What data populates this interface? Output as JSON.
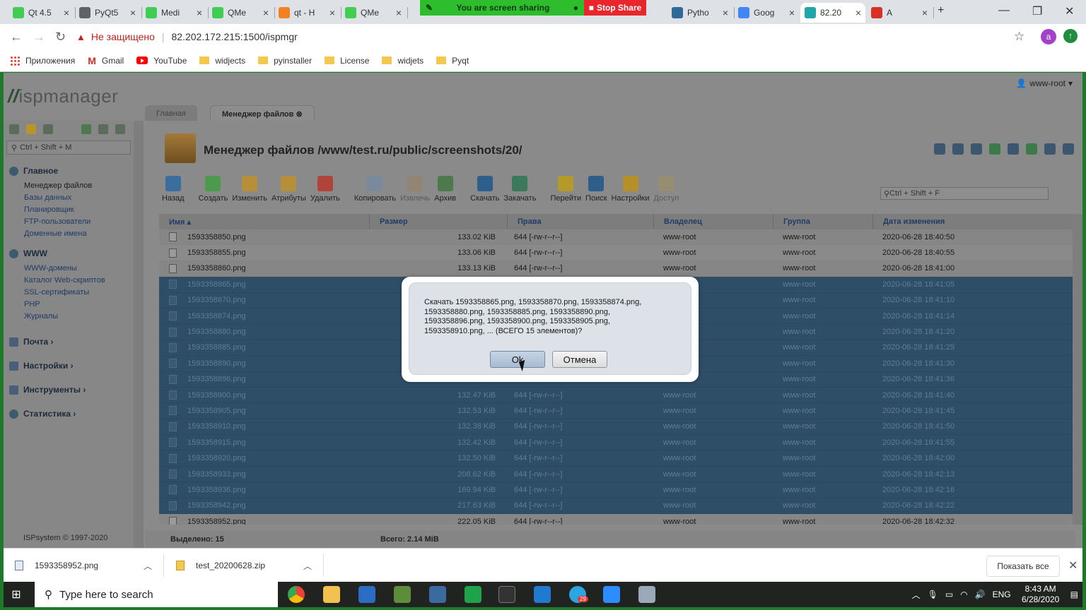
{
  "browser": {
    "tabs": [
      {
        "label": "Qt 4.5",
        "icon": "qt-icon"
      },
      {
        "label": "PyQt5",
        "icon": "globe-icon"
      },
      {
        "label": "Medi",
        "icon": "qt-icon"
      },
      {
        "label": "QMe",
        "icon": "qt-icon"
      },
      {
        "label": "qt - H",
        "icon": "stackoverflow-icon"
      },
      {
        "label": "QMe",
        "icon": "qt-icon"
      },
      {
        "label": "Pytho",
        "icon": "python-icon"
      },
      {
        "label": "Goog",
        "icon": "translate-icon"
      },
      {
        "label": "82.20",
        "icon": "ispmanager-icon"
      },
      {
        "label": "A",
        "icon": "record-icon"
      }
    ],
    "share_text": "You are screen sharing",
    "stop_share_label": "Stop Share",
    "insecure_label": "Не защищено",
    "url": "82.202.172.215:1500/ispmgr",
    "avatar_letter": "a",
    "bookmarks": [
      {
        "label": "Приложения",
        "icon": "apps-icon"
      },
      {
        "label": "Gmail",
        "icon": "gmail-icon"
      },
      {
        "label": "YouTube",
        "icon": "youtube-icon"
      },
      {
        "label": "widjects",
        "icon": "folder-icon"
      },
      {
        "label": "pyinstaller",
        "icon": "folder-icon"
      },
      {
        "label": "License",
        "icon": "folder-icon"
      },
      {
        "label": "widjets",
        "icon": "folder-icon"
      },
      {
        "label": "Pyqt",
        "icon": "folder-icon"
      }
    ]
  },
  "app": {
    "logo_prefix": "//",
    "logo_text": "ispmanager",
    "user": "www-root",
    "tabs": [
      "Главная",
      "Менеджер файлов"
    ],
    "sidebar_search_placeholder": "Ctrl + Shift + M",
    "sections": [
      {
        "title": "Главное",
        "items": [
          "Менеджер файлов",
          "Базы данных",
          "Планировщик",
          "FTP-пользователи",
          "Доменные имена"
        ]
      },
      {
        "title": "WWW",
        "items": [
          "WWW-домены",
          "Каталог Web-скриптов",
          "SSL-сертификаты",
          "PHP",
          "Журналы"
        ]
      },
      {
        "title": "Почта ›",
        "items": []
      },
      {
        "title": "Настройки ›",
        "items": []
      },
      {
        "title": "Инструменты ›",
        "items": []
      },
      {
        "title": "Статистика ›",
        "items": []
      }
    ],
    "copyright": "ISPsystem © 1997-2020",
    "title": "Менеджер файлов /www/test.ru/public/screenshots/20/",
    "toolbar": [
      {
        "label": "Назад",
        "enabled": true,
        "color": "#3b6e9e"
      },
      {
        "label": "Создать",
        "enabled": true,
        "color": "#4c9a4c"
      },
      {
        "label": "Изменить",
        "enabled": true,
        "color": "#b58f3a"
      },
      {
        "label": "Атрибуты",
        "enabled": true,
        "color": "#b58f3a"
      },
      {
        "label": "Удалить",
        "enabled": true,
        "color": "#b0443a"
      },
      {
        "label": "Копировать",
        "enabled": true,
        "color": "#7a8a9a"
      },
      {
        "label": "Извлечь",
        "enabled": false,
        "color": "#9a8060"
      },
      {
        "label": "Архив",
        "enabled": true,
        "color": "#4c7a4c"
      },
      {
        "label": "Скачать",
        "enabled": true,
        "color": "#2d5f8a"
      },
      {
        "label": "Закачать",
        "enabled": true,
        "color": "#3a7a5a"
      },
      {
        "label": "Перейти",
        "enabled": true,
        "color": "#b59a2a"
      },
      {
        "label": "Поиск",
        "enabled": true,
        "color": "#2d5f8a"
      },
      {
        "label": "Настройки",
        "enabled": true,
        "color": "#b5902a"
      },
      {
        "label": "Доступ",
        "enabled": false,
        "color": "#a09060"
      }
    ],
    "file_search_placeholder": "Ctrl + Shift + F",
    "columns": [
      "Имя ▴",
      "Размер",
      "Права",
      "Владелец",
      "Группа",
      "Дата изменения"
    ],
    "files": [
      {
        "name": "1593358850.png",
        "size": "133.02 KiB",
        "perm": "644 [-rw-r--r--]",
        "owner": "www-root",
        "group": "www-root",
        "date": "2020-06-28 18:40:50",
        "selected": false
      },
      {
        "name": "1593358855.png",
        "size": "133.06 KiB",
        "perm": "644 [-rw-r--r--]",
        "owner": "www-root",
        "group": "www-root",
        "date": "2020-06-28 18:40:55",
        "selected": false
      },
      {
        "name": "1593358860.png",
        "size": "133.13 KiB",
        "perm": "644 [-rw-r--r--]",
        "owner": "www-root",
        "group": "www-root",
        "date": "2020-06-28 18:41:00",
        "selected": false
      },
      {
        "name": "1593358865.png",
        "size": "",
        "perm": "",
        "owner": "",
        "group": "www-root",
        "date": "2020-06-28 18:41:05",
        "selected": true
      },
      {
        "name": "1593358870.png",
        "size": "",
        "perm": "",
        "owner": "",
        "group": "www-root",
        "date": "2020-06-28 18:41:10",
        "selected": true
      },
      {
        "name": "1593358874.png",
        "size": "",
        "perm": "",
        "owner": "",
        "group": "www-root",
        "date": "2020-06-28 18:41:14",
        "selected": true
      },
      {
        "name": "1593358880.png",
        "size": "",
        "perm": "",
        "owner": "",
        "group": "www-root",
        "date": "2020-06-28 18:41:20",
        "selected": true
      },
      {
        "name": "1593358885.png",
        "size": "",
        "perm": "",
        "owner": "",
        "group": "www-root",
        "date": "2020-06-28 18:41:25",
        "selected": true
      },
      {
        "name": "1593358890.png",
        "size": "",
        "perm": "",
        "owner": "",
        "group": "www-root",
        "date": "2020-06-28 18:41:30",
        "selected": true
      },
      {
        "name": "1593358896.png",
        "size": "",
        "perm": "",
        "owner": "",
        "group": "www-root",
        "date": "2020-06-28 18:41:36",
        "selected": true
      },
      {
        "name": "1593358900.png",
        "size": "132.47 KiB",
        "perm": "644 [-rw-r--r--]",
        "owner": "www-root",
        "group": "www-root",
        "date": "2020-06-28 18:41:40",
        "selected": true
      },
      {
        "name": "1593358905.png",
        "size": "132.53 KiB",
        "perm": "644 [-rw-r--r--]",
        "owner": "www-root",
        "group": "www-root",
        "date": "2020-06-28 18:41:45",
        "selected": true
      },
      {
        "name": "1593358910.png",
        "size": "132.38 KiB",
        "perm": "644 [-rw-r--r--]",
        "owner": "www-root",
        "group": "www-root",
        "date": "2020-06-28 18:41:50",
        "selected": true
      },
      {
        "name": "1593358915.png",
        "size": "132.42 KiB",
        "perm": "644 [-rw-r--r--]",
        "owner": "www-root",
        "group": "www-root",
        "date": "2020-06-28 18:41:55",
        "selected": true
      },
      {
        "name": "1593358920.png",
        "size": "132.50 KiB",
        "perm": "644 [-rw-r--r--]",
        "owner": "www-root",
        "group": "www-root",
        "date": "2020-06-28 18:42:00",
        "selected": true
      },
      {
        "name": "1593358933.png",
        "size": "208.62 KiB",
        "perm": "644 [-rw-r--r--]",
        "owner": "www-root",
        "group": "www-root",
        "date": "2020-06-28 18:42:13",
        "selected": true
      },
      {
        "name": "1593358936.png",
        "size": "169.94 KiB",
        "perm": "644 [-rw-r--r--]",
        "owner": "www-root",
        "group": "www-root",
        "date": "2020-06-28 18:42:16",
        "selected": true
      },
      {
        "name": "1593358942.png",
        "size": "217.63 KiB",
        "perm": "644 [-rw-r--r--]",
        "owner": "www-root",
        "group": "www-root",
        "date": "2020-06-28 18:42:22",
        "selected": true
      },
      {
        "name": "1593358952.png",
        "size": "222.05 KiB",
        "perm": "644 [-rw-r--r--]",
        "owner": "www-root",
        "group": "www-root",
        "date": "2020-06-28 18:42:32",
        "selected": false
      }
    ],
    "selected_label": "Выделено: 15",
    "total_label": "Всего: 2.14 MiB",
    "dialog": {
      "line1": "Скачать 1593358865.png, 1593358870.png, 1593358874.png,",
      "line2": "1593358880.png, 1593358885.png, 1593358890.png,",
      "line3": "1593358896.png, 1593358900.png, 1593358905.png,",
      "line4": "1593358910.png, ... (ВСЕГО 15 элементов)?",
      "ok_label": "Ok",
      "cancel_label": "Отмена"
    }
  },
  "downloads": {
    "items": [
      {
        "name": "1593358952.png",
        "icon": "image-file-icon"
      },
      {
        "name": "test_20200628.zip",
        "icon": "zip-file-icon"
      }
    ],
    "show_all_label": "Показать все"
  },
  "taskbar": {
    "search_placeholder": "Type here to search",
    "language": "ENG",
    "time": "8:43 AM",
    "date": "6/28/2020",
    "telegram_badge": "29"
  }
}
